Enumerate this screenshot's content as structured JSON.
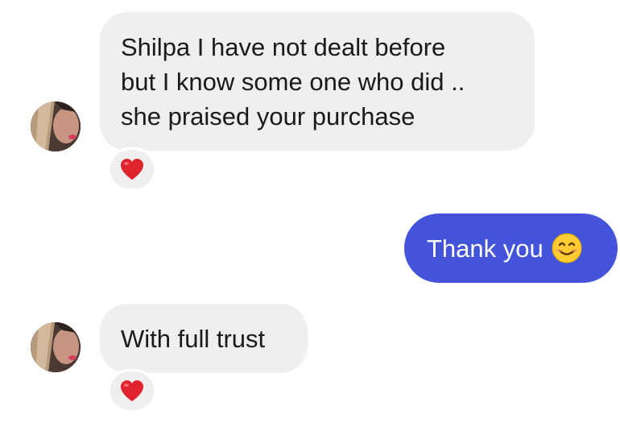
{
  "conversation": {
    "messages": [
      {
        "sender": "other",
        "lines": [
          "Shilpa I have not dealt before",
          "but I know some one who did ..",
          "she praised your purchase"
        ],
        "reaction": "heart"
      },
      {
        "sender": "me",
        "text": "Thank you",
        "emoji": "smiling-face"
      },
      {
        "sender": "other",
        "lines": [
          "With full trust"
        ],
        "reaction": "heart"
      }
    ]
  },
  "colors": {
    "incoming_bubble": "#efefef",
    "outgoing_bubble": "#4454da",
    "incoming_text": "#1a1a1a",
    "outgoing_text": "#ffffff",
    "heart": "#e0242e"
  },
  "icons": {
    "reaction": "heart-icon",
    "emoji": "smiling-face-icon",
    "avatar": "user-avatar"
  }
}
